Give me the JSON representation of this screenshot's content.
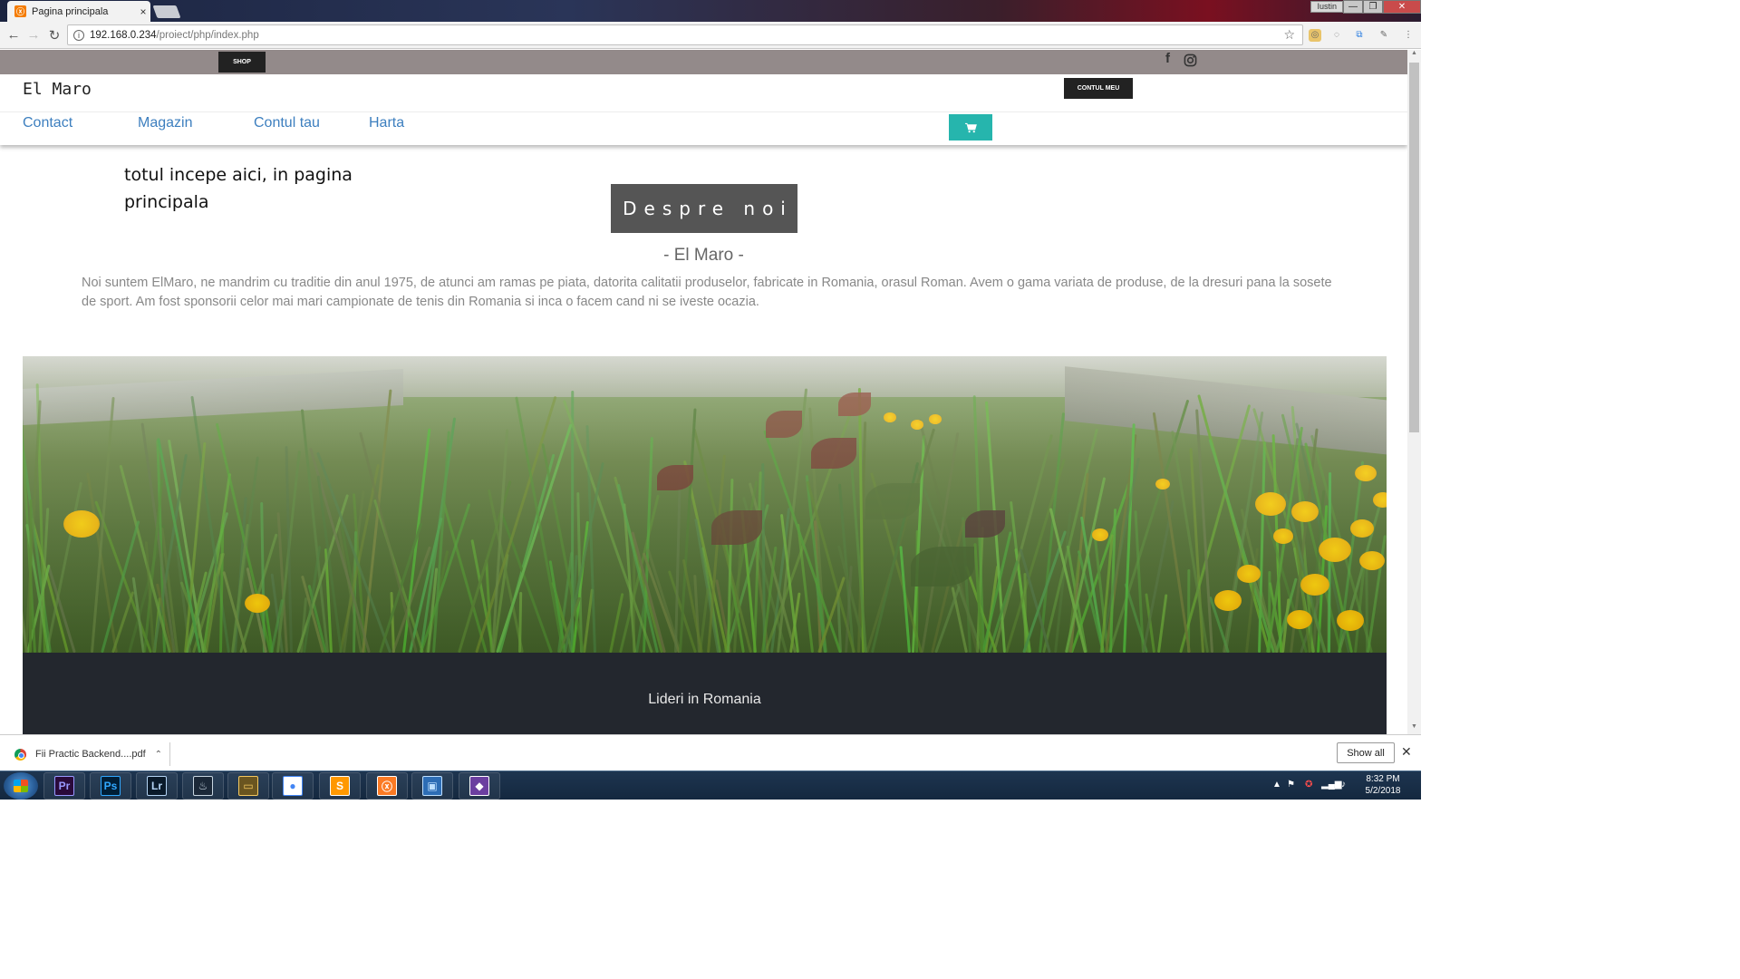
{
  "browser": {
    "tab_title": "Pagina principala",
    "tab_close": "×",
    "user_name": "Iustin",
    "window_buttons": [
      "—",
      "❐",
      "✕"
    ],
    "url_host": "192.168.0.234",
    "url_path": "/proiect/php/index.php"
  },
  "site": {
    "topbar": {
      "shop_label": "SHOP",
      "social_icons": [
        "facebook-icon",
        "instagram-icon"
      ]
    },
    "brand": "El Maro",
    "account_label": "CONTUL MEU",
    "nav": [
      "Contact",
      "Magazin",
      "Contul tau",
      "Harta"
    ],
    "tagline": "totul incepe aici, in pagina principala",
    "about_button": "Despre noi",
    "subtitle": "- El Maro -",
    "description": "Noi suntem ElMaro, ne mandrim cu traditie din anul 1975, de atunci am ramas pe piata, datorita calitatii produselor, fabricate in Romania, orasul Roman. Avem o gama variata de produse, de la dresuri pana la sosete de sport. Am fost sponsorii celor mai mari campionate de tenis din Romania si inca o facem cand ni se iveste ocazia.",
    "dark_section_title": "Lideri in Romania",
    "colors": {
      "topbar": "#938a8a",
      "nav_link": "#3d7fbf",
      "cart_button": "#26b5ad",
      "about_button": "#555555",
      "dark_section": "#23272e"
    }
  },
  "downloads": {
    "file_name": "Fii Practic Backend....pdf",
    "show_all": "Show all"
  },
  "taskbar": {
    "apps": [
      {
        "name": "premiere-pro",
        "label": "Pr",
        "color": "#9999ff",
        "bg": "#2a0a3a"
      },
      {
        "name": "photoshop",
        "label": "Ps",
        "color": "#31a8ff",
        "bg": "#001e36"
      },
      {
        "name": "lightroom",
        "label": "Lr",
        "color": "#b4d4f4",
        "bg": "#0a1a2a"
      },
      {
        "name": "steam",
        "label": "♨",
        "color": "#c7d5e0",
        "bg": "#1b2838"
      },
      {
        "name": "file-explorer",
        "label": "▭",
        "color": "#f3c75f",
        "bg": "#6a5520"
      },
      {
        "name": "chrome",
        "label": "●",
        "color": "#4285f4",
        "bg": "#ffffff"
      },
      {
        "name": "sublime-text",
        "label": "S",
        "color": "#ffffff",
        "bg": "#ff9800"
      },
      {
        "name": "xampp",
        "label": "ⓧ",
        "color": "#ffffff",
        "bg": "#fb7a24"
      },
      {
        "name": "remote-desktop",
        "label": "▣",
        "color": "#bfe0ff",
        "bg": "#2d6db5"
      },
      {
        "name": "git-tool",
        "label": "◆",
        "color": "#ffffff",
        "bg": "#6b3fa0"
      }
    ],
    "time": "8:32 PM",
    "date": "5/2/2018"
  }
}
